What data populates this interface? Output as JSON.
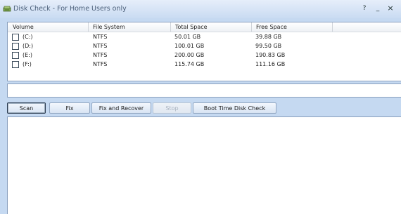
{
  "window": {
    "title": "Disk Check - For Home Users only",
    "help_label": "?",
    "minimize_label": "_",
    "close_label": "×"
  },
  "volume_table": {
    "columns": [
      "Volume",
      "File System",
      "Total Space",
      "Free Space"
    ],
    "rows": [
      {
        "volume": "(C:)",
        "file_system": "NTFS",
        "total": "50.01 GB",
        "free": "39.88 GB",
        "checked": false
      },
      {
        "volume": "(D:)",
        "file_system": "NTFS",
        "total": "100.01 GB",
        "free": "99.50 GB",
        "checked": false
      },
      {
        "volume": "(E:)",
        "file_system": "NTFS",
        "total": "200.00 GB",
        "free": "190.83 GB",
        "checked": false
      },
      {
        "volume": "(F:)",
        "file_system": "NTFS",
        "total": "115.74 GB",
        "free": "111.16 GB",
        "checked": false
      }
    ]
  },
  "status_field": {
    "value": ""
  },
  "buttons": {
    "scan": "Scan",
    "fix": "Fix",
    "fix_and_recover": "Fix and Recover",
    "stop": "Stop",
    "boot_time": "Boot Time Disk Check"
  },
  "output": {
    "text": ""
  }
}
